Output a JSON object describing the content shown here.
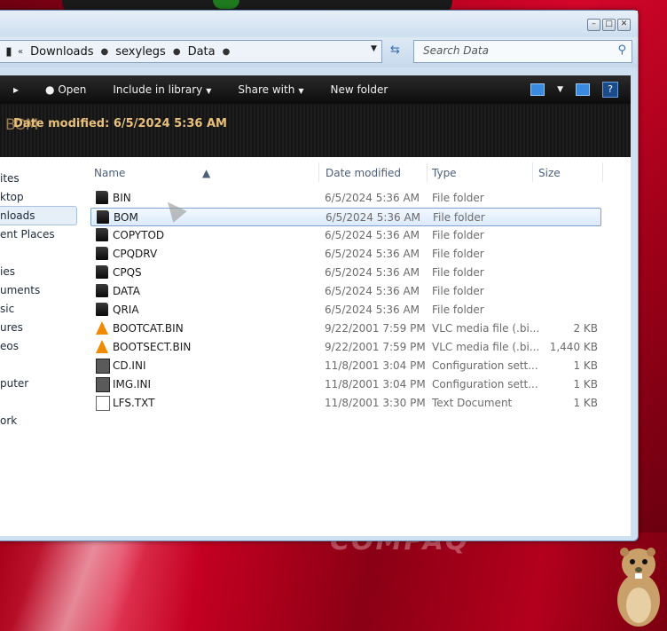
{
  "address": {
    "crumbs": [
      "Downloads",
      "sexylegs",
      "Data"
    ],
    "search_placeholder": "Search Data"
  },
  "toolbar": {
    "open": "Open",
    "include_in_library": "Include in library",
    "share_with": "Share with",
    "new_folder": "New folder"
  },
  "details_bar": {
    "overlap_text": "BOM",
    "date_modified": "Date modified: 6/5/2024 5:36 AM"
  },
  "nav_pane": [
    "ites",
    "ktop",
    "nloads",
    "ent Places",
    "ies",
    "uments",
    "sic",
    "ures",
    "eos",
    "puter",
    "ork"
  ],
  "columns": {
    "name": "Name",
    "date": "Date modified",
    "type": "Type",
    "size": "Size"
  },
  "files": [
    {
      "name": "BIN",
      "date": "6/5/2024 5:36 AM",
      "type": "File folder",
      "size": "",
      "icon": "folder-icon"
    },
    {
      "name": "BOM",
      "date": "6/5/2024 5:36 AM",
      "type": "File folder",
      "size": "",
      "icon": "folder-icon",
      "selected": true
    },
    {
      "name": "COPYTOD",
      "date": "6/5/2024 5:36 AM",
      "type": "File folder",
      "size": "",
      "icon": "folder-icon"
    },
    {
      "name": "CPQDRV",
      "date": "6/5/2024 5:36 AM",
      "type": "File folder",
      "size": "",
      "icon": "folder-icon"
    },
    {
      "name": "CPQS",
      "date": "6/5/2024 5:36 AM",
      "type": "File folder",
      "size": "",
      "icon": "folder-icon"
    },
    {
      "name": "DATA",
      "date": "6/5/2024 5:36 AM",
      "type": "File folder",
      "size": "",
      "icon": "folder-icon"
    },
    {
      "name": "QRIA",
      "date": "6/5/2024 5:36 AM",
      "type": "File folder",
      "size": "",
      "icon": "folder-icon"
    },
    {
      "name": "BOOTCAT.BIN",
      "date": "9/22/2001 7:59 PM",
      "type": "VLC media file (.bi...",
      "size": "2 KB",
      "icon": "vlc-icon"
    },
    {
      "name": "BOOTSECT.BIN",
      "date": "9/22/2001 7:59 PM",
      "type": "VLC media file (.bi...",
      "size": "1,440 KB",
      "icon": "vlc-icon"
    },
    {
      "name": "CD.INI",
      "date": "11/8/2001 3:04 PM",
      "type": "Configuration sett...",
      "size": "1 KB",
      "icon": "config-file-icon"
    },
    {
      "name": "IMG.INI",
      "date": "11/8/2001 3:04 PM",
      "type": "Configuration sett...",
      "size": "1 KB",
      "icon": "config-file-icon"
    },
    {
      "name": "LFS.TXT",
      "date": "11/8/2001 3:30 PM",
      "type": "Text Document",
      "size": "1 KB",
      "icon": "text-file-icon"
    }
  ],
  "wallpaper": {
    "brand_text": "COMPAQ"
  },
  "colors": {
    "accent": "#3a6fb0",
    "selection_border": "#7da2ce",
    "wallpaper_red": "#b4001e"
  }
}
